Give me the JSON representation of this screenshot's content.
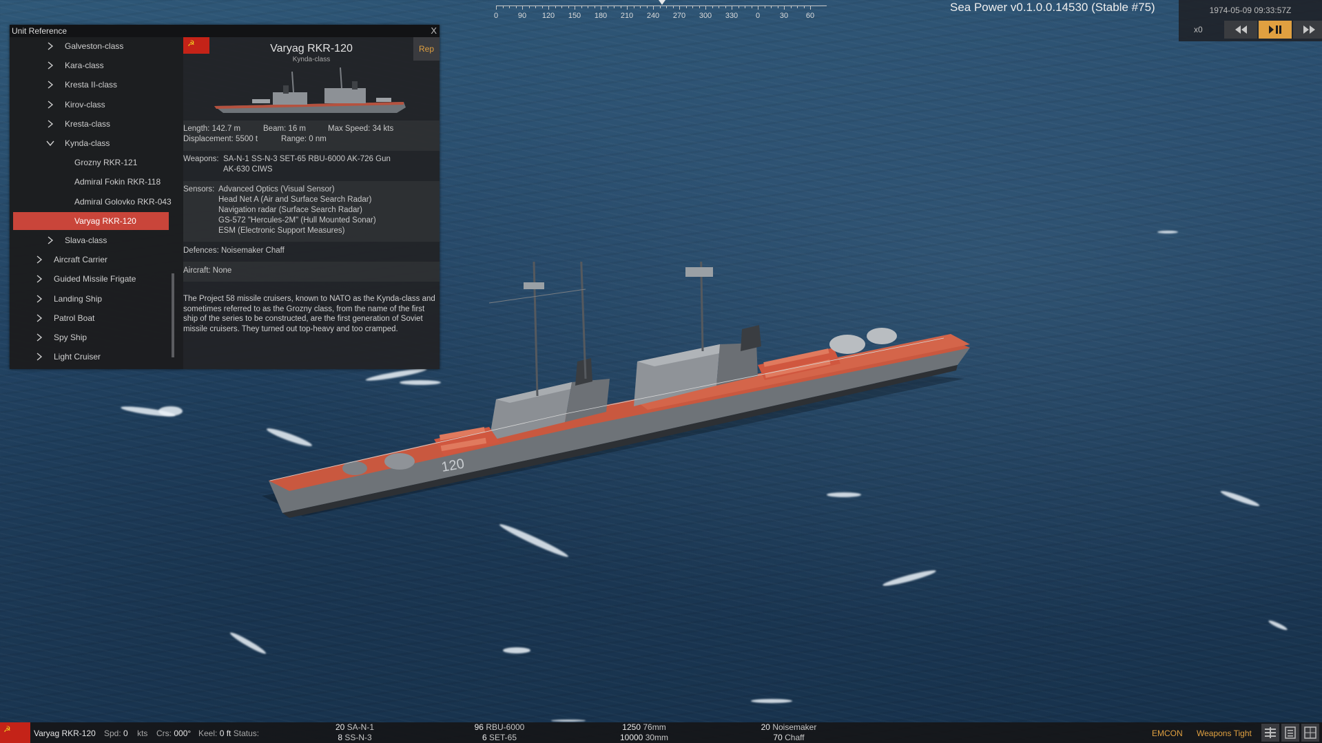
{
  "app": {
    "version": "Sea Power v0.1.0.0.14530 (Stable #75)"
  },
  "compass": {
    "labels": [
      "0",
      "90",
      "120",
      "150",
      "180",
      "210",
      "240",
      "270",
      "300",
      "330",
      "0",
      "30",
      "60"
    ]
  },
  "time_panel": {
    "datetime": "1974-05-09 09:33:57Z",
    "multiplier": "x0",
    "rewind_icon": "rewind-icon",
    "play_pause_icon": "play-pause-icon",
    "fast_forward_icon": "fast-forward-icon"
  },
  "unit_reference": {
    "title": "Unit Reference",
    "close_label": "X",
    "tree": [
      {
        "label": "Galveston-class",
        "level": 2,
        "expanded": false
      },
      {
        "label": "Kara-class",
        "level": 2,
        "expanded": false
      },
      {
        "label": "Kresta II-class",
        "level": 2,
        "expanded": false
      },
      {
        "label": "Kirov-class",
        "level": 2,
        "expanded": false
      },
      {
        "label": "Kresta-class",
        "level": 2,
        "expanded": false
      },
      {
        "label": "Kynda-class",
        "level": 2,
        "expanded": true
      },
      {
        "label": "Grozny RKR-121",
        "level": 3
      },
      {
        "label": "Admiral Fokin RKR-118",
        "level": 3
      },
      {
        "label": "Admiral Golovko RKR-043",
        "level": 3
      },
      {
        "label": "Varyag RKR-120",
        "level": 3,
        "selected": true
      },
      {
        "label": "Slava-class",
        "level": 2,
        "expanded": false
      },
      {
        "label": "Aircraft Carrier",
        "level": 1,
        "expanded": false
      },
      {
        "label": "Guided Missile Frigate",
        "level": 1,
        "expanded": false
      },
      {
        "label": "Landing Ship",
        "level": 1,
        "expanded": false
      },
      {
        "label": "Patrol Boat",
        "level": 1,
        "expanded": false
      },
      {
        "label": "Spy Ship",
        "level": 1,
        "expanded": false
      },
      {
        "label": "Light Cruiser",
        "level": 1,
        "expanded": false
      }
    ],
    "detail": {
      "name": "Varyag RKR-120",
      "class": "Kynda-class",
      "rep_label": "Rep",
      "length": "Length: 142.7 m",
      "beam": "Beam: 16 m",
      "max_speed": "Max Speed: 34 kts",
      "displacement": "Displacement: 5500 t",
      "range": "Range: 0 nm",
      "weapons_label": "Weapons:",
      "weapons_line1": "SA-N-1  SS-N-3  SET-65  RBU-6000  AK-726 Gun",
      "weapons_line2": "AK-630 CIWS",
      "sensors_label": "Sensors:",
      "sensors": [
        "Advanced Optics (Visual Sensor)",
        "Head Net A (Air and Surface Search Radar)",
        "Navigation radar (Surface Search Radar)",
        "GS-572 \"Hercules-2M\" (Hull Mounted Sonar)",
        "ESM (Electronic Support Measures)"
      ],
      "defences": "Defences:  Noisemaker  Chaff",
      "aircraft": "Aircraft:  None",
      "description": "The Project 58 missile cruisers, known to NATO as the Kynda-class and sometimes referred to as the Grozny class, from the name of the first ship of the series to be constructed, are the first generation of Soviet missile cruisers. They turned out top-heavy and too cramped."
    }
  },
  "hull_number": "120",
  "bottom_bar": {
    "unit_name": "Varyag RKR-120",
    "spd_label": "Spd:",
    "spd_value": "0",
    "spd_unit": "kts",
    "crs_label": "Crs:",
    "crs_value": "000°",
    "keel_label": "Keel:",
    "keel_value": "0 ft",
    "status_label": "Status:",
    "weapons": [
      {
        "count1": "20",
        "name1": "SA-N-1",
        "count2": "8",
        "name2": "SS-N-3"
      },
      {
        "count1": "96",
        "name1": "RBU-6000",
        "count2": "6",
        "name2": "SET-65"
      },
      {
        "count1": "1250",
        "name1": "76mm",
        "count2": "10000",
        "name2": "30mm"
      },
      {
        "count1": "20",
        "name1": "Noisemaker",
        "count2": "70",
        "name2": "Chaff"
      }
    ],
    "emcon": "EMCON",
    "weapons_state": "Weapons Tight"
  },
  "colors": {
    "accent": "#e0a040",
    "selection": "#c9453a",
    "soviet_red": "#c42318"
  }
}
